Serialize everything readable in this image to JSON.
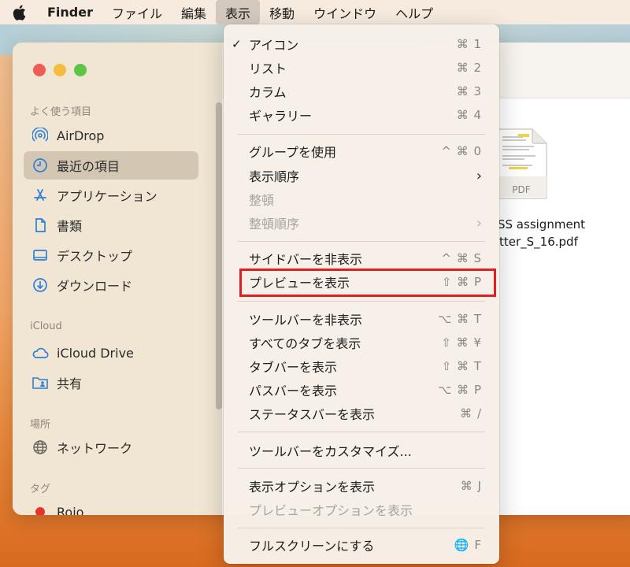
{
  "menubar": {
    "app": "Finder",
    "items": [
      "ファイル",
      "編集",
      "表示",
      "移動",
      "ウインドウ",
      "ヘルプ"
    ]
  },
  "sidebar": {
    "favorites_title": "よく使う項目",
    "favorites": [
      {
        "label": "AirDrop",
        "icon": "airdrop-icon"
      },
      {
        "label": "最近の項目",
        "icon": "clock-icon",
        "selected": true
      },
      {
        "label": "アプリケーション",
        "icon": "app-icon"
      },
      {
        "label": "書類",
        "icon": "document-icon"
      },
      {
        "label": "デスクトップ",
        "icon": "desktop-icon"
      },
      {
        "label": "ダウンロード",
        "icon": "download-icon"
      }
    ],
    "icloud_title": "iCloud",
    "icloud": [
      {
        "label": "iCloud Drive",
        "icon": "cloud-icon"
      },
      {
        "label": "共有",
        "icon": "shared-folder-icon"
      }
    ],
    "locations_title": "場所",
    "locations": [
      {
        "label": "ネットワーク",
        "icon": "network-icon"
      }
    ],
    "tags_title": "タグ",
    "tags": [
      {
        "label": "Rojo",
        "color": "#e5322d"
      }
    ]
  },
  "file": {
    "type_label": "PDF",
    "name_line1": "SS assignment",
    "name_line2": "tter_S_16.pdf"
  },
  "view_menu": {
    "items": [
      {
        "label": "アイコン",
        "shortcut": "⌘ 1",
        "checked": "✓"
      },
      {
        "label": "リスト",
        "shortcut": "⌘ 2"
      },
      {
        "label": "カラム",
        "shortcut": "⌘ 3"
      },
      {
        "label": "ギャラリー",
        "shortcut": "⌘ 4"
      },
      {
        "label": "グループを使用",
        "shortcut": "^ ⌘ 0"
      },
      {
        "label": "表示順序",
        "submenu": "›"
      },
      {
        "label": "整頓",
        "disabled": true
      },
      {
        "label": "整頓順序",
        "submenu": "›",
        "disabled": true
      },
      {
        "label": "サイドバーを非表示",
        "shortcut": "^ ⌘ S"
      },
      {
        "label": "プレビューを表示",
        "shortcut": "⇧ ⌘ P",
        "highlighted": true
      },
      {
        "label": "ツールバーを非表示",
        "shortcut": "⌥ ⌘ T"
      },
      {
        "label": "すべてのタブを表示",
        "shortcut": "⇧ ⌘ ¥"
      },
      {
        "label": "タブバーを表示",
        "shortcut": "⇧ ⌘ T"
      },
      {
        "label": "パスバーを表示",
        "shortcut": "⌥ ⌘ P"
      },
      {
        "label": "ステータスバーを表示",
        "shortcut": "⌘ /"
      },
      {
        "label": "ツールバーをカスタマイズ..."
      },
      {
        "label": "表示オプションを表示",
        "shortcut": "⌘ J"
      },
      {
        "label": "プレビューオプションを表示",
        "disabled": true
      },
      {
        "label": "フルスクリーンにする",
        "shortcut": "🌐 F"
      }
    ]
  },
  "colors": {
    "highlight_border": "#e11f1f",
    "accent": "#2f7fd9"
  }
}
